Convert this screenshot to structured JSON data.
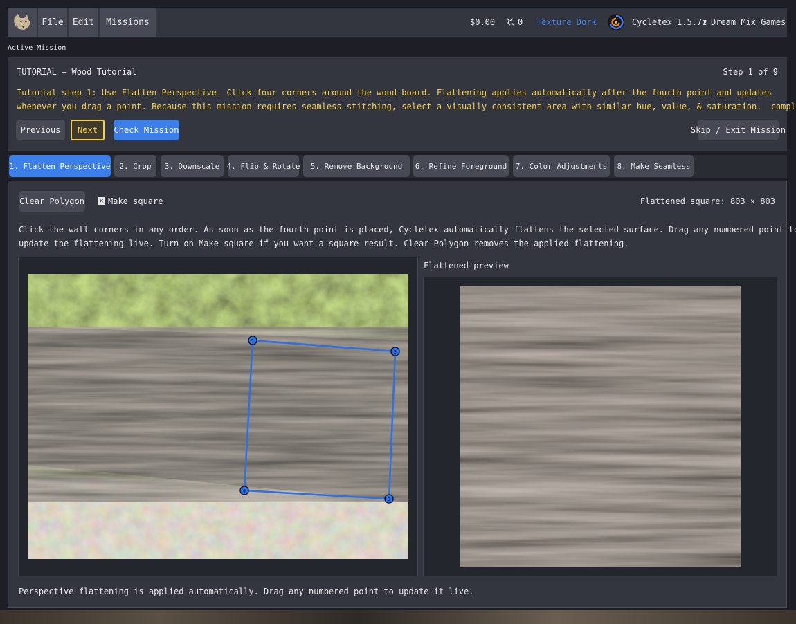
{
  "menu": {
    "file": "File",
    "edit": "Edit",
    "missions": "Missions"
  },
  "status": {
    "money": "$0.00",
    "gear_count": "0",
    "user": "Texture Dork",
    "app_version": "Cycletex 1.5.7z",
    "separator": "•",
    "company": "Dream Mix Games"
  },
  "mission": {
    "section_label": "Active Mission",
    "title": "TUTORIAL — Wood Tutorial",
    "step_counter": "Step 1 of 9",
    "instruction_line1": "Tutorial step 1: Use Flatten Perspective. Click four corners around the wood board. Flattening applies automatically after the fourth point and updates",
    "instruction_line2": "whenever you drag a point. Because this mission requires seamless stitching, select a visually consistent area with similar hue, value, & saturation.",
    "completed": "completed",
    "check_glyph": "✔",
    "prev_label": "Previous",
    "next_label": "Next",
    "check_label": "Check Mission",
    "skip_label": "Skip / Exit Mission"
  },
  "tabs": [
    {
      "label": "1. Flatten Perspective",
      "active": true
    },
    {
      "label": "2. Crop"
    },
    {
      "label": "3. Downscale"
    },
    {
      "label": "4. Flip & Rotate"
    },
    {
      "label": "5. Remove Background"
    },
    {
      "label": "6. Refine Foreground"
    },
    {
      "label": "7. Color Adjustments"
    },
    {
      "label": "8. Make Seamless"
    }
  ],
  "flatten": {
    "clear_label": "Clear Polygon",
    "make_square_label": "Make square",
    "make_square_checked": true,
    "checkbox_glyph": "✕",
    "size_label": "Flattened square: 803 × 803",
    "help_line1": "Click the wall corners in any order. As soon as the fourth point is placed, Cycletex automatically flattens the selected surface. Drag any numbered point to",
    "help_line2": "update the flattening live. Turn on Make square if you want a square result. Clear Polygon removes the applied flattening.",
    "preview_label": "Flattened preview",
    "footer_note": "Perspective flattening is applied automatically. Drag any numbered point to update it live.",
    "points": [
      {
        "label": "1"
      },
      {
        "label": "2"
      },
      {
        "label": "3"
      },
      {
        "label": "4"
      }
    ]
  },
  "colors": {
    "accent": "#3d7fe8",
    "warning": "#f4cf4b",
    "polygon": "#2f6fe0",
    "user_link": "#3d7fe8"
  }
}
